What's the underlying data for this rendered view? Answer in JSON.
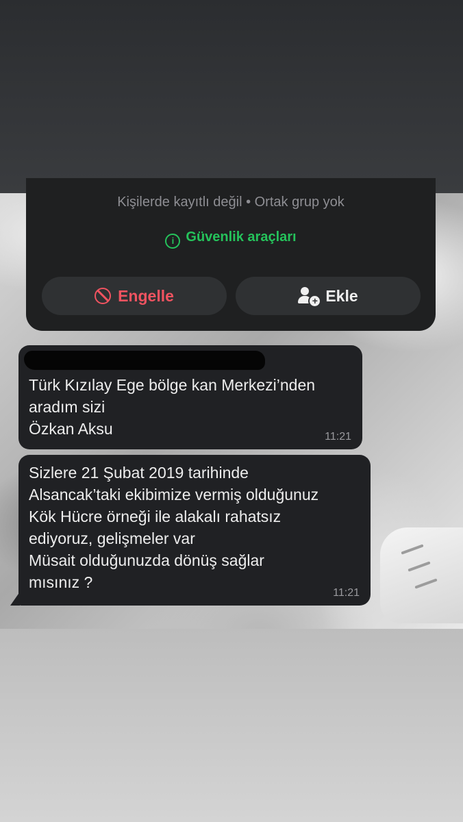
{
  "contact_card": {
    "subtitle": "Kişilerde kayıtlı değil • Ortak grup yok",
    "security_tools": "Güvenlik araçları",
    "block_label": "Engelle",
    "add_label": "Ekle"
  },
  "messages": [
    {
      "lines": [
        "Türk Kızılay Ege bölge kan Merkezi’nden",
        "aradım sizi",
        "Özkan Aksu"
      ],
      "time": "11:21"
    },
    {
      "lines": [
        "Sizlere 21 Şubat 2019 tarihinde",
        "Alsancak’taki ekibimize vermiş olduğunuz",
        "Kök Hücre örneği ile alakalı rahatsız",
        "ediyoruz, gelişmeler var",
        "Müsait olduğunuzda dönüş sağlar",
        "mısınız ?"
      ],
      "time": "11:21"
    }
  ],
  "icons": {
    "security": "info-circle-icon",
    "block": "block-icon",
    "add": "add-person-icon"
  },
  "colors": {
    "security_green": "#25c25b",
    "block_red": "#f15360",
    "bubble_bg": "#202124",
    "card_bg": "#1f2021"
  }
}
